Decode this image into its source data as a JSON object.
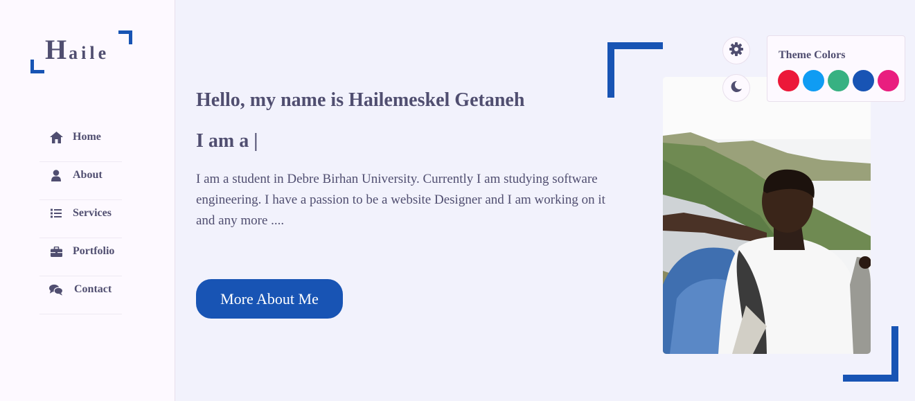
{
  "sidebar": {
    "logo": {
      "initial": "H",
      "rest": "aile"
    },
    "nav": [
      {
        "label": "Home",
        "icon": "home-icon"
      },
      {
        "label": "About",
        "icon": "user-icon"
      },
      {
        "label": "Services",
        "icon": "list-icon"
      },
      {
        "label": "Portfolio",
        "icon": "briefcase-icon"
      },
      {
        "label": "Contact",
        "icon": "comments-icon"
      }
    ]
  },
  "home": {
    "greeting": "Hello, my name is Hailemeskel Getaneh",
    "typing": "I am a |",
    "bio": "I am a student in Debre Birhan University. Currently I am studying software engineering. I have a passion to be a website Designer and I am working on it and any more ....",
    "button_label": "More About Me"
  },
  "style_switcher": {
    "settings_icon": "gear-icon",
    "dark_mode_icon": "moon-icon",
    "title": "Theme Colors",
    "colors": [
      "#ec1839",
      "#0f9cf3",
      "#37b182",
      "#1854b4",
      "#e91e7f"
    ]
  },
  "colors": {
    "accent": "#1854b4",
    "text": "#504e70",
    "background": "#f2f2fc",
    "sidebar": "#fdf9ff"
  }
}
